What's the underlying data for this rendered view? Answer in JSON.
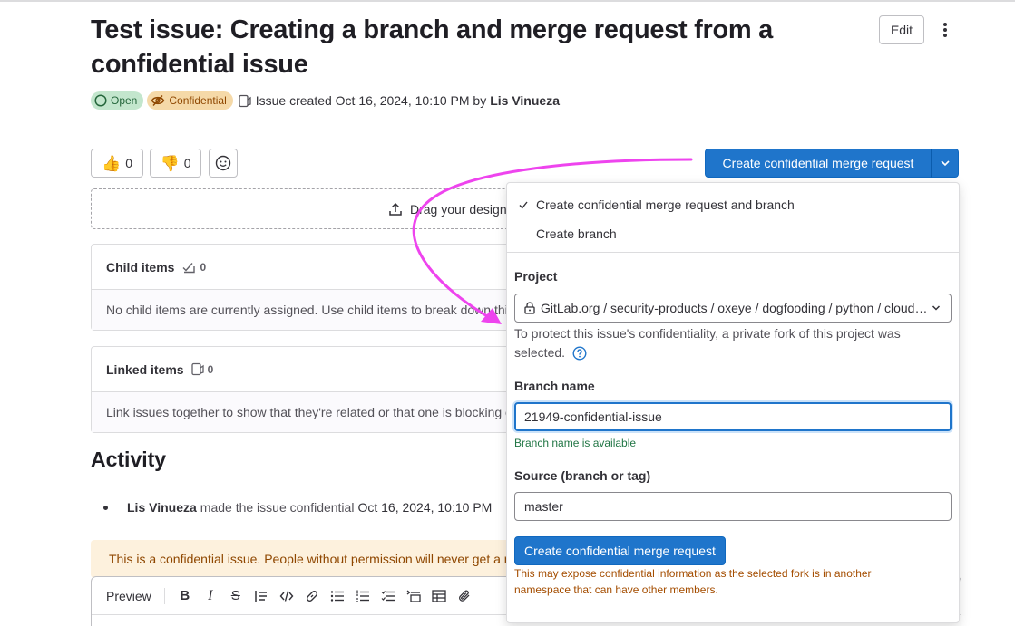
{
  "issue": {
    "title": "Test issue: Creating a branch and merge request from a confidential issue",
    "edit_label": "Edit",
    "status_badge": "Open",
    "confidential_badge": "Confidential",
    "created_text": "Issue created Oct 16, 2024, 10:10 PM by",
    "author": "Lis Vinueza"
  },
  "reactions": {
    "thumbs_up_count": "0",
    "thumbs_down_count": "0"
  },
  "design_drop": {
    "text": "Drag your designs here or click to upload."
  },
  "child_items": {
    "title": "Child items",
    "count": "0",
    "empty_text": "No child items are currently assigned. Use child items to break down this issue into smaller parts."
  },
  "linked_items": {
    "title": "Linked items",
    "count": "0",
    "empty_text": "Link issues together to show that they're related or that one is blocking others."
  },
  "activity": {
    "heading": "Activity",
    "item": {
      "author": "Lis Vinueza",
      "action": "made the issue confidential",
      "timestamp": "Oct 16, 2024, 10:10 PM"
    },
    "warning": "This is a confidential issue. People without permission will never get a notification."
  },
  "editor": {
    "preview_label": "Preview"
  },
  "merge_request": {
    "button_label": "Create confidential merge request",
    "options": [
      {
        "label": "Create confidential merge request and branch",
        "selected": true
      },
      {
        "label": "Create branch",
        "selected": false
      }
    ],
    "project_label": "Project",
    "project_value": "GitLab.org / security-products / oxeye / dogfooding / python / cloud-native-app",
    "project_help": "To protect this issue's confidentiality, a private fork of this project was selected.",
    "branch_label": "Branch name",
    "branch_value": "21949-confidential-issue",
    "branch_status": "Branch name is available",
    "source_label": "Source (branch or tag)",
    "source_value": "master",
    "submit_label": "Create confidential merge request",
    "warning": "This may expose confidential information as the selected fork is in another namespace that can have other members."
  },
  "colors": {
    "primary": "#1f75cb",
    "annotation_arrow": "#ee44ee",
    "success": "#217645",
    "warning_text": "#a44d00"
  }
}
